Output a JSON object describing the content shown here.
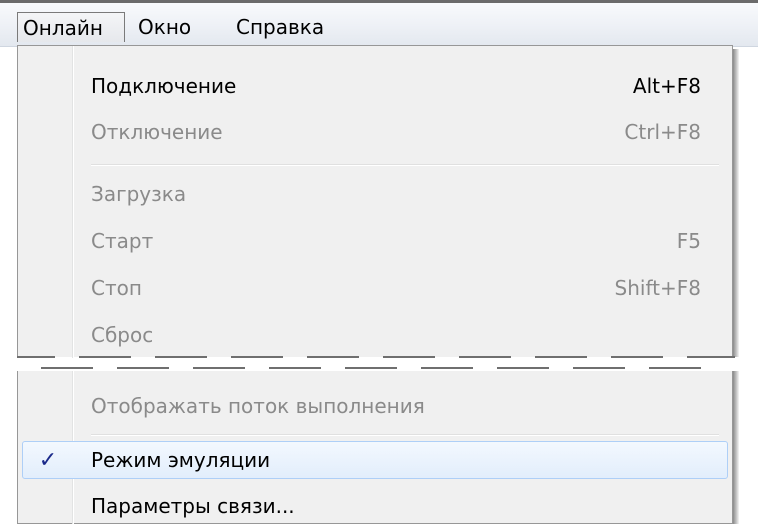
{
  "menubar": {
    "items": [
      {
        "label": "Онлайн"
      },
      {
        "label": "Окно"
      },
      {
        "label": "Справка"
      }
    ]
  },
  "dropdown": {
    "items": [
      {
        "label": "Подключение",
        "shortcut": "Alt+F8",
        "enabled": true
      },
      {
        "label": "Отключение",
        "shortcut": "Ctrl+F8",
        "enabled": false
      },
      {
        "label": "Загрузка",
        "shortcut": "",
        "enabled": false
      },
      {
        "label": "Старт",
        "shortcut": "F5",
        "enabled": false
      },
      {
        "label": "Стоп",
        "shortcut": "Shift+F8",
        "enabled": false
      },
      {
        "label": "Сброс",
        "shortcut": "",
        "enabled": false
      },
      {
        "label": "Отображать поток выполнения",
        "shortcut": "",
        "enabled": false
      },
      {
        "label": "Режим эмуляции",
        "shortcut": "",
        "enabled": true,
        "checked": true,
        "check_glyph": "✓"
      },
      {
        "label": "Параметры связи...",
        "shortcut": "",
        "enabled": true
      }
    ]
  },
  "colors": {
    "enabled_text": "#000000",
    "disabled_text": "#8a8a8a",
    "check_mark": "#1b2a8a",
    "highlight_border": "#aecff7"
  }
}
